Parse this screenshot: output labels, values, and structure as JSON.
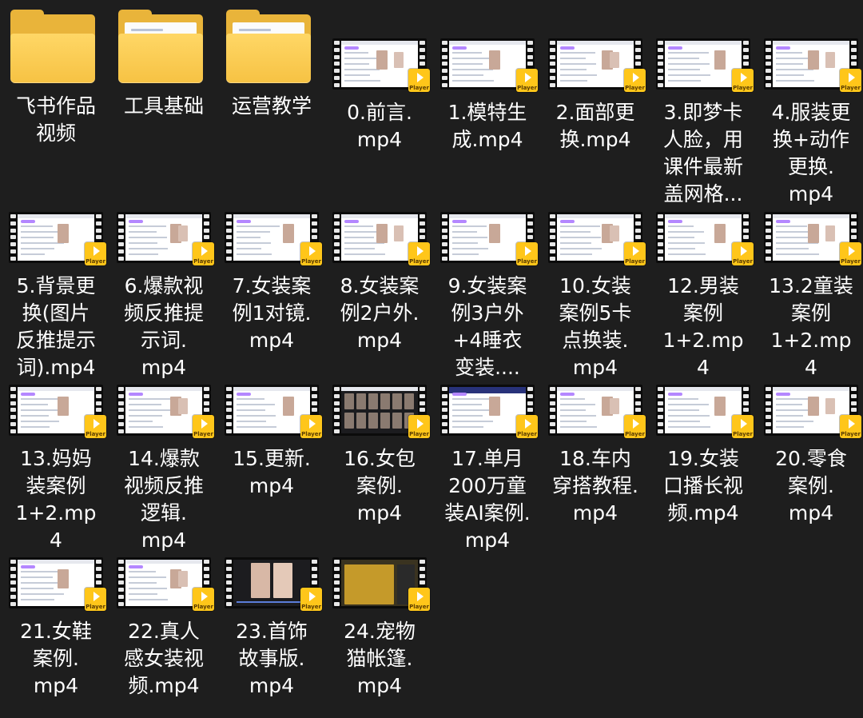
{
  "folders": [
    {
      "name": "飞书作品视频",
      "lines": [
        "飞书作品",
        "视频"
      ]
    },
    {
      "name": "工具基础",
      "lines": [
        "工具基础"
      ]
    },
    {
      "name": "运营教学",
      "lines": [
        "运营教学"
      ]
    }
  ],
  "videos": [
    {
      "lines": [
        "0.前言.",
        "mp4"
      ],
      "badge": "Player"
    },
    {
      "lines": [
        "1.模特生",
        "成.mp4"
      ],
      "badge": "Player"
    },
    {
      "lines": [
        "2.面部更",
        "换.mp4"
      ],
      "badge": "Player"
    },
    {
      "lines": [
        "3.即梦卡",
        "人脸，用",
        "课件最新",
        "盖网格..."
      ],
      "badge": "Player"
    },
    {
      "lines": [
        "4.服装更",
        "换+动作",
        "更换.",
        "mp4"
      ],
      "badge": "Player"
    },
    {
      "lines": [
        "5.背景更",
        "换(图片",
        "反推提示",
        "词).mp4"
      ],
      "badge": "Player"
    },
    {
      "lines": [
        "6.爆款视",
        "频反推提",
        "示词.",
        "mp4"
      ],
      "badge": "Player"
    },
    {
      "lines": [
        "7.女装案",
        "例1对镜.",
        "mp4"
      ],
      "badge": "Player"
    },
    {
      "lines": [
        "8.女装案",
        "例2户外.",
        "mp4"
      ],
      "badge": "Player"
    },
    {
      "lines": [
        "9.女装案",
        "例3户外",
        "+4睡衣",
        "变装...."
      ],
      "badge": "Player"
    },
    {
      "lines": [
        "10.女装",
        "案例5卡",
        "点换装.",
        "mp4"
      ],
      "badge": "Player"
    },
    {
      "lines": [
        "12.男装",
        "案例",
        "1+2.mp",
        "4"
      ],
      "badge": "Player"
    },
    {
      "lines": [
        "13.2童装",
        "案例",
        "1+2.mp",
        "4"
      ],
      "badge": "Player"
    },
    {
      "lines": [
        "13.妈妈",
        "装案例",
        "1+2.mp",
        "4"
      ],
      "badge": "Player"
    },
    {
      "lines": [
        "14.爆款",
        "视频反推",
        "逻辑.",
        "mp4"
      ],
      "badge": "Player"
    },
    {
      "lines": [
        "15.更新.",
        "mp4"
      ],
      "badge": "Player"
    },
    {
      "lines": [
        "16.女包",
        "案例.",
        "mp4"
      ],
      "badge": "Player"
    },
    {
      "lines": [
        "17.单月",
        "200万童",
        "装AI案例.",
        "mp4"
      ],
      "badge": "Player"
    },
    {
      "lines": [
        "18.车内",
        "穿搭教程.",
        "mp4"
      ],
      "badge": "Player"
    },
    {
      "lines": [
        "19.女装",
        "口播长视",
        "频.mp4"
      ],
      "badge": "Player"
    },
    {
      "lines": [
        "20.零食",
        "案例.",
        "mp4"
      ],
      "badge": "Player"
    },
    {
      "lines": [
        "21.女鞋",
        "案例.",
        "mp4"
      ],
      "badge": "Player"
    },
    {
      "lines": [
        "22.真人",
        "感女装视",
        "频.mp4"
      ],
      "badge": "Player"
    },
    {
      "lines": [
        "23.首饰",
        "故事版.",
        "mp4"
      ],
      "badge": "Player"
    },
    {
      "lines": [
        "24.宠物",
        "猫帐篷.",
        "mp4"
      ],
      "badge": "Player"
    }
  ],
  "colors": {
    "background": "#1e1e1e",
    "folder": "#f6c243",
    "badge": "#ffc61a",
    "text": "#ffffff"
  }
}
